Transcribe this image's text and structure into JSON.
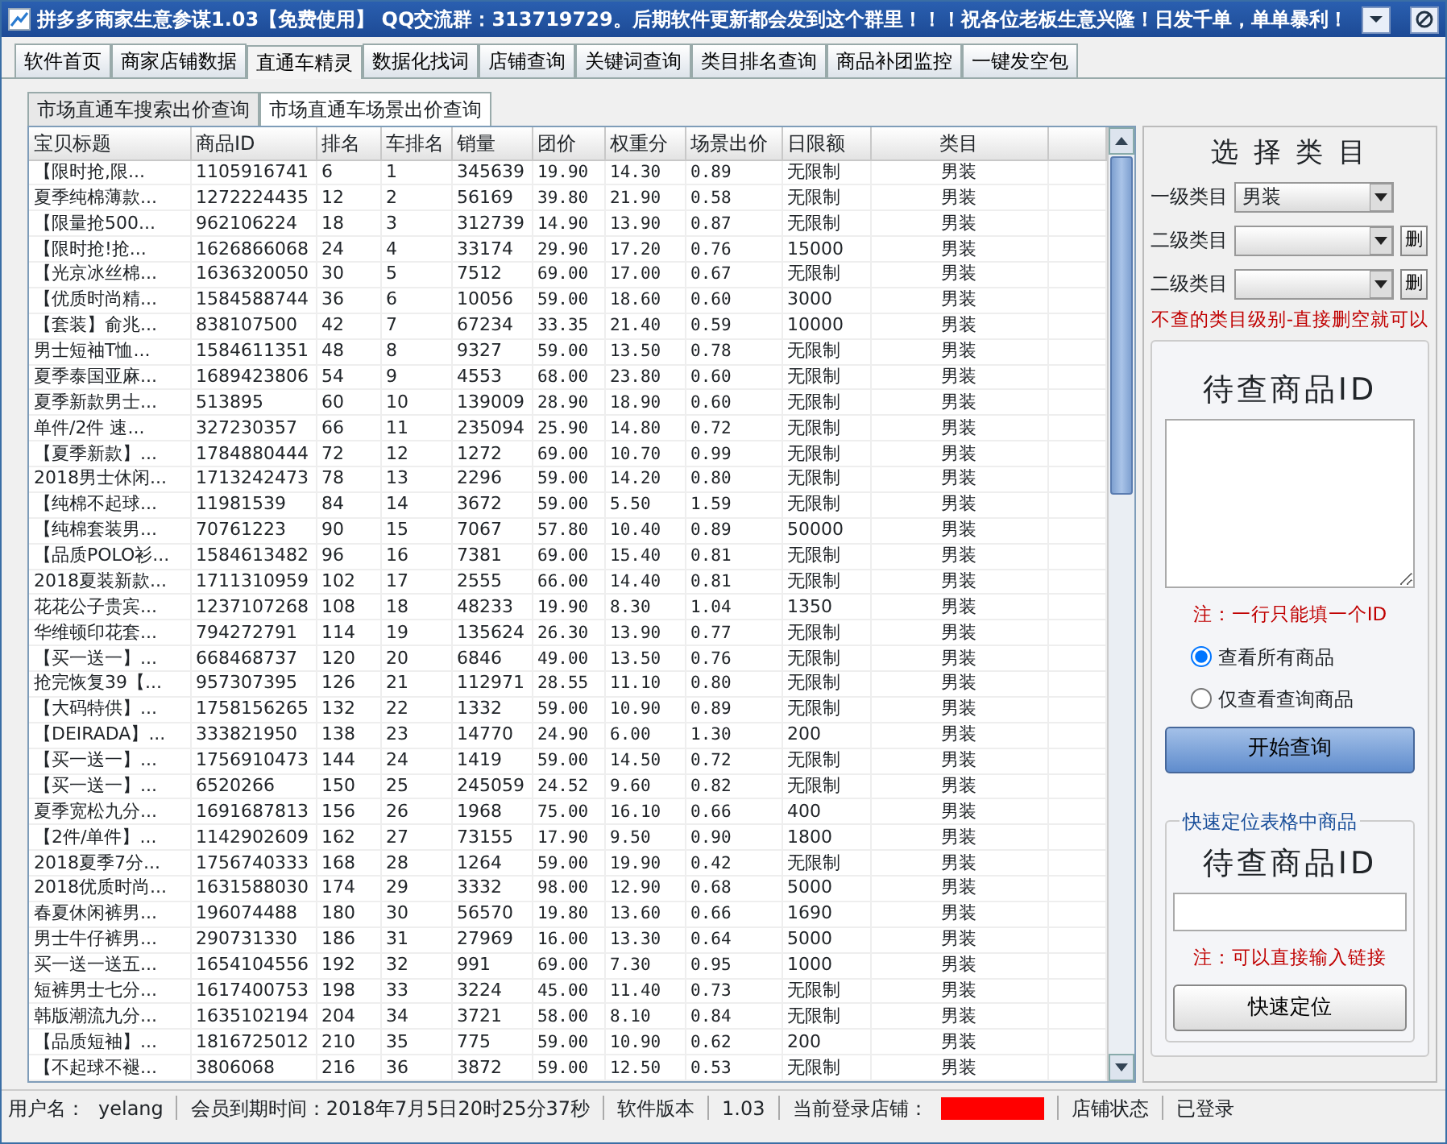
{
  "window": {
    "title": "拼多多商家生意参谋1.03【免费使用】 QQ交流群：313719729。后期软件更新都会发到这个群里！！！祝各位老板生意兴隆！日发千单，单单暴利！"
  },
  "tabs": [
    {
      "label": "软件首页",
      "selected": false
    },
    {
      "label": "商家店铺数据",
      "selected": false
    },
    {
      "label": "直通车精灵",
      "selected": true
    },
    {
      "label": "数据化找词",
      "selected": false
    },
    {
      "label": "店铺查询",
      "selected": false
    },
    {
      "label": "关键词查询",
      "selected": false
    },
    {
      "label": "类目排名查询",
      "selected": false
    },
    {
      "label": "商品补团监控",
      "selected": false
    },
    {
      "label": "一键发空包",
      "selected": false
    }
  ],
  "subtabs": [
    {
      "label": "市场直通车搜索出价查询",
      "selected": false
    },
    {
      "label": "市场直通车场景出价查询",
      "selected": true
    }
  ],
  "table": {
    "columns": [
      "宝贝标题",
      "商品ID",
      "排名",
      "车排名",
      "销量",
      "团价",
      "权重分",
      "场景出价",
      "日限额",
      "类目"
    ],
    "rows": [
      [
        "【限时抢,限...",
        "1105916741",
        "6",
        "1",
        "345639",
        "19.90",
        "14.30",
        "0.89",
        "无限制",
        "男装"
      ],
      [
        "夏季纯棉薄款...",
        "1272224435",
        "12",
        "2",
        "56169",
        "39.80",
        "21.90",
        "0.58",
        "无限制",
        "男装"
      ],
      [
        "【限量抢500...",
        "962106224",
        "18",
        "3",
        "312739",
        "14.90",
        "13.90",
        "0.87",
        "无限制",
        "男装"
      ],
      [
        "【限时抢!抢...",
        "1626866068",
        "24",
        "4",
        "33174",
        "29.90",
        "17.20",
        "0.76",
        "15000",
        "男装"
      ],
      [
        "【光京冰丝棉...",
        "1636320050",
        "30",
        "5",
        "7512",
        "69.00",
        "17.00",
        "0.67",
        "无限制",
        "男装"
      ],
      [
        "【优质时尚精...",
        "1584588744",
        "36",
        "6",
        "10056",
        "59.00",
        "18.60",
        "0.60",
        "3000",
        "男装"
      ],
      [
        "【套装】俞兆...",
        "838107500",
        "42",
        "7",
        "67234",
        "33.35",
        "21.40",
        "0.59",
        "10000",
        "男装"
      ],
      [
        "男士短袖T恤...",
        "1584611351",
        "48",
        "8",
        "9327",
        "59.00",
        "13.50",
        "0.78",
        "无限制",
        "男装"
      ],
      [
        "夏季泰国亚麻...",
        "1689423806",
        "54",
        "9",
        "4553",
        "68.00",
        "23.80",
        "0.60",
        "无限制",
        "男装"
      ],
      [
        "夏季新款男士...",
        "513895",
        "60",
        "10",
        "139009",
        "28.90",
        "18.90",
        "0.60",
        "无限制",
        "男装"
      ],
      [
        "单件/2件 速...",
        "327230357",
        "66",
        "11",
        "235094",
        "25.90",
        "14.80",
        "0.72",
        "无限制",
        "男装"
      ],
      [
        "【夏季新款】...",
        "1784880444",
        "72",
        "12",
        "1272",
        "69.00",
        "10.70",
        "0.99",
        "无限制",
        "男装"
      ],
      [
        "2018男士休闲...",
        "1713242473",
        "78",
        "13",
        "2296",
        "59.00",
        "14.20",
        "0.80",
        "无限制",
        "男装"
      ],
      [
        "【纯棉不起球...",
        "11981539",
        "84",
        "14",
        "3672",
        "59.00",
        "5.50",
        "1.59",
        "无限制",
        "男装"
      ],
      [
        "【纯棉套装男...",
        "70761223",
        "90",
        "15",
        "7067",
        "57.80",
        "10.40",
        "0.89",
        "50000",
        "男装"
      ],
      [
        "【品质POLO衫...",
        "1584613482",
        "96",
        "16",
        "7381",
        "69.00",
        "15.40",
        "0.81",
        "无限制",
        "男装"
      ],
      [
        "2018夏装新款...",
        "1711310959",
        "102",
        "17",
        "2555",
        "66.00",
        "14.40",
        "0.81",
        "无限制",
        "男装"
      ],
      [
        "花花公子贵宾...",
        "1237107268",
        "108",
        "18",
        "48233",
        "19.90",
        "8.30",
        "1.04",
        "1350",
        "男装"
      ],
      [
        "华维顿印花套...",
        "794272791",
        "114",
        "19",
        "135624",
        "26.30",
        "13.90",
        "0.77",
        "无限制",
        "男装"
      ],
      [
        "【买一送一】...",
        "668468737",
        "120",
        "20",
        "6846",
        "49.00",
        "13.50",
        "0.76",
        "无限制",
        "男装"
      ],
      [
        "抢完恢复39【...",
        "957307395",
        "126",
        "21",
        "112971",
        "28.55",
        "11.10",
        "0.80",
        "无限制",
        "男装"
      ],
      [
        "【大码特供】...",
        "1758156265",
        "132",
        "22",
        "1332",
        "59.00",
        "10.90",
        "0.89",
        "无限制",
        "男装"
      ],
      [
        "【DEIRADA】...",
        "333821950",
        "138",
        "23",
        "14770",
        "24.90",
        "6.00",
        "1.30",
        "200",
        "男装"
      ],
      [
        "【买一送一】...",
        "1756910473",
        "144",
        "24",
        "1419",
        "59.00",
        "14.50",
        "0.72",
        "无限制",
        "男装"
      ],
      [
        "【买一送一】...",
        "6520266",
        "150",
        "25",
        "245059",
        "24.52",
        "9.60",
        "0.82",
        "无限制",
        "男装"
      ],
      [
        "夏季宽松九分...",
        "1691687813",
        "156",
        "26",
        "1968",
        "75.00",
        "16.10",
        "0.66",
        "400",
        "男装"
      ],
      [
        "【2件/单件】...",
        "1142902609",
        "162",
        "27",
        "73155",
        "17.90",
        "9.50",
        "0.90",
        "1800",
        "男装"
      ],
      [
        "2018夏季7分...",
        "1756740333",
        "168",
        "28",
        "1264",
        "59.00",
        "19.90",
        "0.42",
        "无限制",
        "男装"
      ],
      [
        "2018优质时尚...",
        "1631588030",
        "174",
        "29",
        "3332",
        "98.00",
        "12.90",
        "0.68",
        "5000",
        "男装"
      ],
      [
        "春夏休闲裤男...",
        "196074488",
        "180",
        "30",
        "56570",
        "19.80",
        "13.60",
        "0.66",
        "1690",
        "男装"
      ],
      [
        "男士牛仔裤男...",
        "290731330",
        "186",
        "31",
        "27969",
        "16.00",
        "13.30",
        "0.64",
        "5000",
        "男装"
      ],
      [
        "买一送一送五...",
        "1654104556",
        "192",
        "32",
        "991",
        "69.00",
        "7.30",
        "0.95",
        "1000",
        "男装"
      ],
      [
        "短裤男士七分...",
        "1617400753",
        "198",
        "33",
        "3224",
        "45.00",
        "11.40",
        "0.73",
        "无限制",
        "男装"
      ],
      [
        "韩版潮流九分...",
        "1635102194",
        "204",
        "34",
        "3721",
        "58.00",
        "8.10",
        "0.84",
        "无限制",
        "男装"
      ],
      [
        "【品质短袖】...",
        "1816725012",
        "210",
        "35",
        "775",
        "59.00",
        "10.90",
        "0.62",
        "200",
        "男装"
      ],
      [
        "【不起球不褪...",
        "3806068",
        "216",
        "36",
        "3872",
        "59.00",
        "12.50",
        "0.53",
        "无限制",
        "男装"
      ]
    ]
  },
  "category_panel": {
    "title": "选 择 类 目",
    "selects": [
      {
        "label": "一级类目",
        "value": "男装"
      },
      {
        "label": "二级类目",
        "delete": "删"
      },
      {
        "label": "二级类目",
        "delete": "删"
      }
    ],
    "hint": "不查的类目级别-直接删空就可以"
  },
  "query_box": {
    "title": "待查商品ID",
    "note": "注：一行只能填一个ID",
    "radios": [
      {
        "label": "查看所有商品",
        "selected": true
      },
      {
        "label": "仅查看查询商品",
        "selected": false
      }
    ],
    "button": "开始查询"
  },
  "locate_box": {
    "legend": "快速定位表格中商品",
    "title": "待查商品ID",
    "note": "注：可以直接输入链接",
    "button": "快速定位"
  },
  "status_bar": [
    {
      "kind": "text",
      "text": "用户名："
    },
    {
      "kind": "text",
      "text": "yelang"
    },
    {
      "kind": "sep"
    },
    {
      "kind": "text",
      "text": "会员到期时间：2018年7月5日20时25分37秒"
    },
    {
      "kind": "sep"
    },
    {
      "kind": "text",
      "text": "软件版本"
    },
    {
      "kind": "sep"
    },
    {
      "kind": "text",
      "text": "1.03"
    },
    {
      "kind": "sep"
    },
    {
      "kind": "text",
      "text": "当前登录店铺："
    },
    {
      "kind": "redacted"
    },
    {
      "kind": "sep"
    },
    {
      "kind": "text",
      "text": "店铺状态"
    },
    {
      "kind": "sep"
    },
    {
      "kind": "text",
      "text": "已登录"
    }
  ]
}
